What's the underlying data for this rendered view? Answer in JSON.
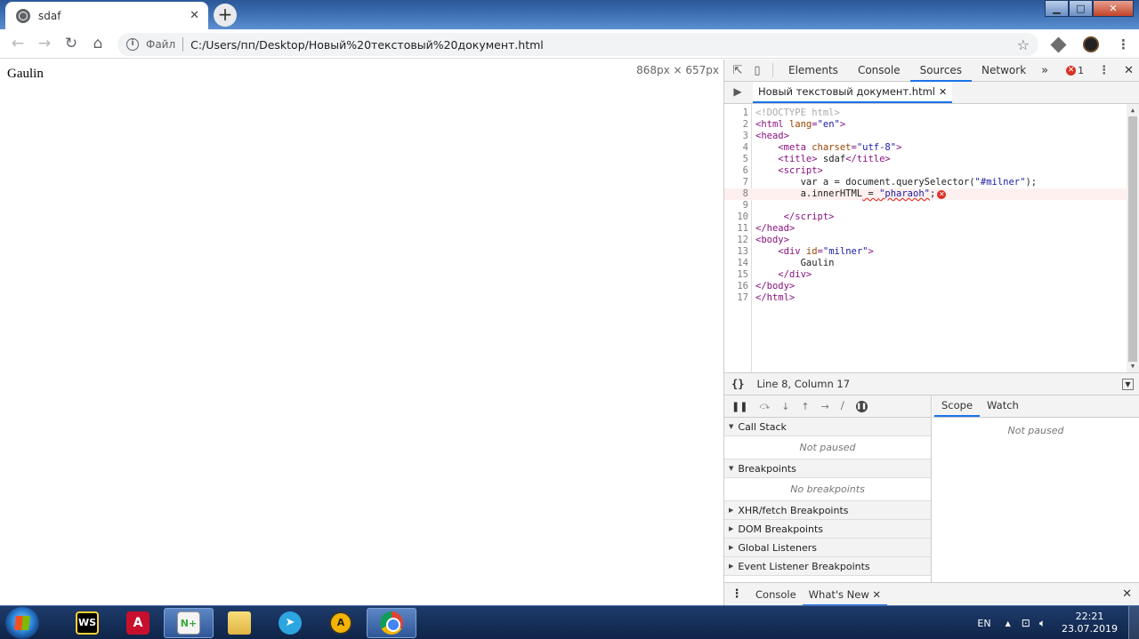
{
  "browser": {
    "tab_title": "sdaf",
    "tab_close": "✕",
    "new_tab": "+",
    "omnibox": {
      "info_glyph": "i",
      "scheme_label": "Файл",
      "url": "C:/Users/пп/Desktop/Новый%20текстовый%20документ.html"
    }
  },
  "page": {
    "body_text": "Gaulin",
    "viewport_size": "868px × 657px"
  },
  "devtools": {
    "tabs": [
      "Elements",
      "Console",
      "Sources",
      "Network"
    ],
    "active_tab": "Sources",
    "more": "»",
    "error_count": "1",
    "open_file": "Новый текстовый документ.html",
    "editor_lines": [
      {
        "n": "1",
        "html": "<span class='tk-doc'>&lt;!DOCTYPE html&gt;</span>"
      },
      {
        "n": "2",
        "html": "<span class='tk-tag'>&lt;html</span> <span class='tk-attr'>lang</span><span class='tk-tag'>=</span><span class='tk-str'>\"en\"</span><span class='tk-tag'>&gt;</span>"
      },
      {
        "n": "3",
        "html": "<span class='tk-tag'>&lt;head&gt;</span>"
      },
      {
        "n": "4",
        "html": "    <span class='tk-tag'>&lt;meta</span> <span class='tk-attr'>charset</span><span class='tk-tag'>=</span><span class='tk-str'>\"utf-8\"</span><span class='tk-tag'>&gt;</span>"
      },
      {
        "n": "5",
        "html": "    <span class='tk-tag'>&lt;title&gt;</span> sdaf<span class='tk-tag'>&lt;/title&gt;</span>"
      },
      {
        "n": "6",
        "html": "    <span class='tk-tag'>&lt;script&gt;</span>"
      },
      {
        "n": "7",
        "html": "        var a = document.querySelector(<span class='tk-str'>\"#milner\"</span>);"
      },
      {
        "n": "8",
        "html": "        a.innerHTML<span class='wavy'> = <span class='tk-str'>\"pharaoh\"</span></span>;<span class='errdot'>✕</span>",
        "error": true
      },
      {
        "n": "9",
        "html": ""
      },
      {
        "n": "10",
        "html": "     <span class='tk-tag'>&lt;/script&gt;</span>"
      },
      {
        "n": "11",
        "html": "<span class='tk-tag'>&lt;/head&gt;</span>"
      },
      {
        "n": "12",
        "html": "<span class='tk-tag'>&lt;body&gt;</span>"
      },
      {
        "n": "13",
        "html": "    <span class='tk-tag'>&lt;div</span> <span class='tk-attr'>id</span><span class='tk-tag'>=</span><span class='tk-str'>\"milner\"</span><span class='tk-tag'>&gt;</span>"
      },
      {
        "n": "14",
        "html": "        Gaulin"
      },
      {
        "n": "15",
        "html": "    <span class='tk-tag'>&lt;/div&gt;</span>"
      },
      {
        "n": "16",
        "html": "<span class='tk-tag'>&lt;/body&gt;</span>"
      },
      {
        "n": "17",
        "html": "<span class='tk-tag'>&lt;/html&gt;</span>"
      }
    ],
    "status": {
      "braces": "{}",
      "position": "Line 8, Column 17"
    },
    "debugger": {
      "call_stack_label": "Call Stack",
      "call_stack_body": "Not paused",
      "breakpoints_label": "Breakpoints",
      "breakpoints_body": "No breakpoints",
      "collapsed_sections": [
        "XHR/fetch Breakpoints",
        "DOM Breakpoints",
        "Global Listeners",
        "Event Listener Breakpoints"
      ],
      "right_tabs": [
        "Scope",
        "Watch"
      ],
      "scope_body": "Not paused"
    },
    "drawer": {
      "tabs": [
        "Console",
        "What's New"
      ],
      "active": "What's New"
    }
  },
  "taskbar": {
    "language": "EN",
    "time": "22:21",
    "date": "23.07.2019",
    "apps": [
      {
        "icon": "webstorm-icon",
        "label": "WS"
      },
      {
        "icon": "acrobat-icon",
        "label": "A"
      },
      {
        "icon": "notepad-plus-icon",
        "label": "N+"
      },
      {
        "icon": "folder-icon",
        "label": ""
      },
      {
        "icon": "telegram-icon",
        "label": "➤"
      },
      {
        "icon": "aimp-icon",
        "label": "A"
      },
      {
        "icon": "chrome-icon",
        "label": ""
      }
    ]
  },
  "colors": {
    "accent": "#1a73e8",
    "error": "#d93025",
    "tag": "#881280",
    "attr": "#994500",
    "string": "#1a1aa6"
  }
}
